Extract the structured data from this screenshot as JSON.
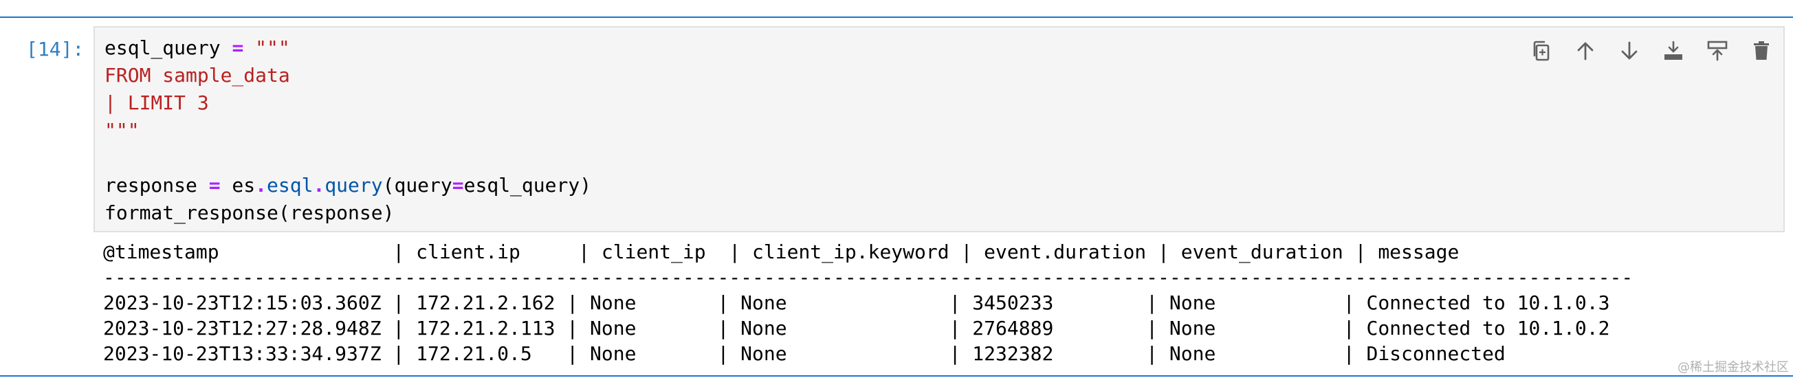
{
  "cell": {
    "prompt": "[14]:",
    "code_lines": [
      [
        {
          "t": "esql_query ",
          "c": ""
        },
        {
          "t": "=",
          "c": "op"
        },
        {
          "t": " \"\"\"",
          "c": "str"
        }
      ],
      [
        {
          "t": "FROM sample_data",
          "c": "str"
        }
      ],
      [
        {
          "t": "| LIMIT 3",
          "c": "str"
        }
      ],
      [
        {
          "t": "\"\"\"",
          "c": "str"
        }
      ],
      [],
      [
        {
          "t": "response ",
          "c": ""
        },
        {
          "t": "=",
          "c": "op"
        },
        {
          "t": " es",
          "c": ""
        },
        {
          "t": ".",
          "c": "op"
        },
        {
          "t": "esql",
          "c": "attr"
        },
        {
          "t": ".",
          "c": "op"
        },
        {
          "t": "query",
          "c": "attr"
        },
        {
          "t": "(query",
          "c": ""
        },
        {
          "t": "=",
          "c": "op"
        },
        {
          "t": "esql_query)",
          "c": ""
        }
      ],
      [
        {
          "t": "format_response(response)",
          "c": ""
        }
      ]
    ],
    "toolbar": [
      {
        "name": "copy-cell-button",
        "icon": "copy-icon"
      },
      {
        "name": "move-up-button",
        "icon": "arrow-up-icon"
      },
      {
        "name": "move-down-button",
        "icon": "arrow-down-icon"
      },
      {
        "name": "insert-below-button",
        "icon": "insert-below-icon"
      },
      {
        "name": "insert-above-button",
        "icon": "insert-above-icon"
      },
      {
        "name": "delete-cell-button",
        "icon": "trash-icon"
      }
    ]
  },
  "output": {
    "header": "@timestamp               | client.ip     | client_ip  | client_ip.keyword | event.duration | event_duration | message",
    "separator": "------------------------------------------------------------------------------------------------------------------------------------",
    "rows": [
      "2023-10-23T12:15:03.360Z | 172.21.2.162 | None       | None              | 3450233        | None           | Connected to 10.1.0.3",
      "2023-10-23T12:27:28.948Z | 172.21.2.113 | None       | None              | 2764889        | None           | Connected to 10.1.0.2",
      "2023-10-23T13:33:34.937Z | 172.21.0.5   | None       | None              | 1232382        | None           | Disconnected"
    ]
  },
  "watermark": "@稀土掘金技术社区",
  "colors": {
    "accent": "#1976d2",
    "prompt": "#307fc1",
    "string": "#ba2121",
    "operator": "#aa22ff",
    "attribute": "#0055aa",
    "cell_background": "#f5f5f5"
  }
}
